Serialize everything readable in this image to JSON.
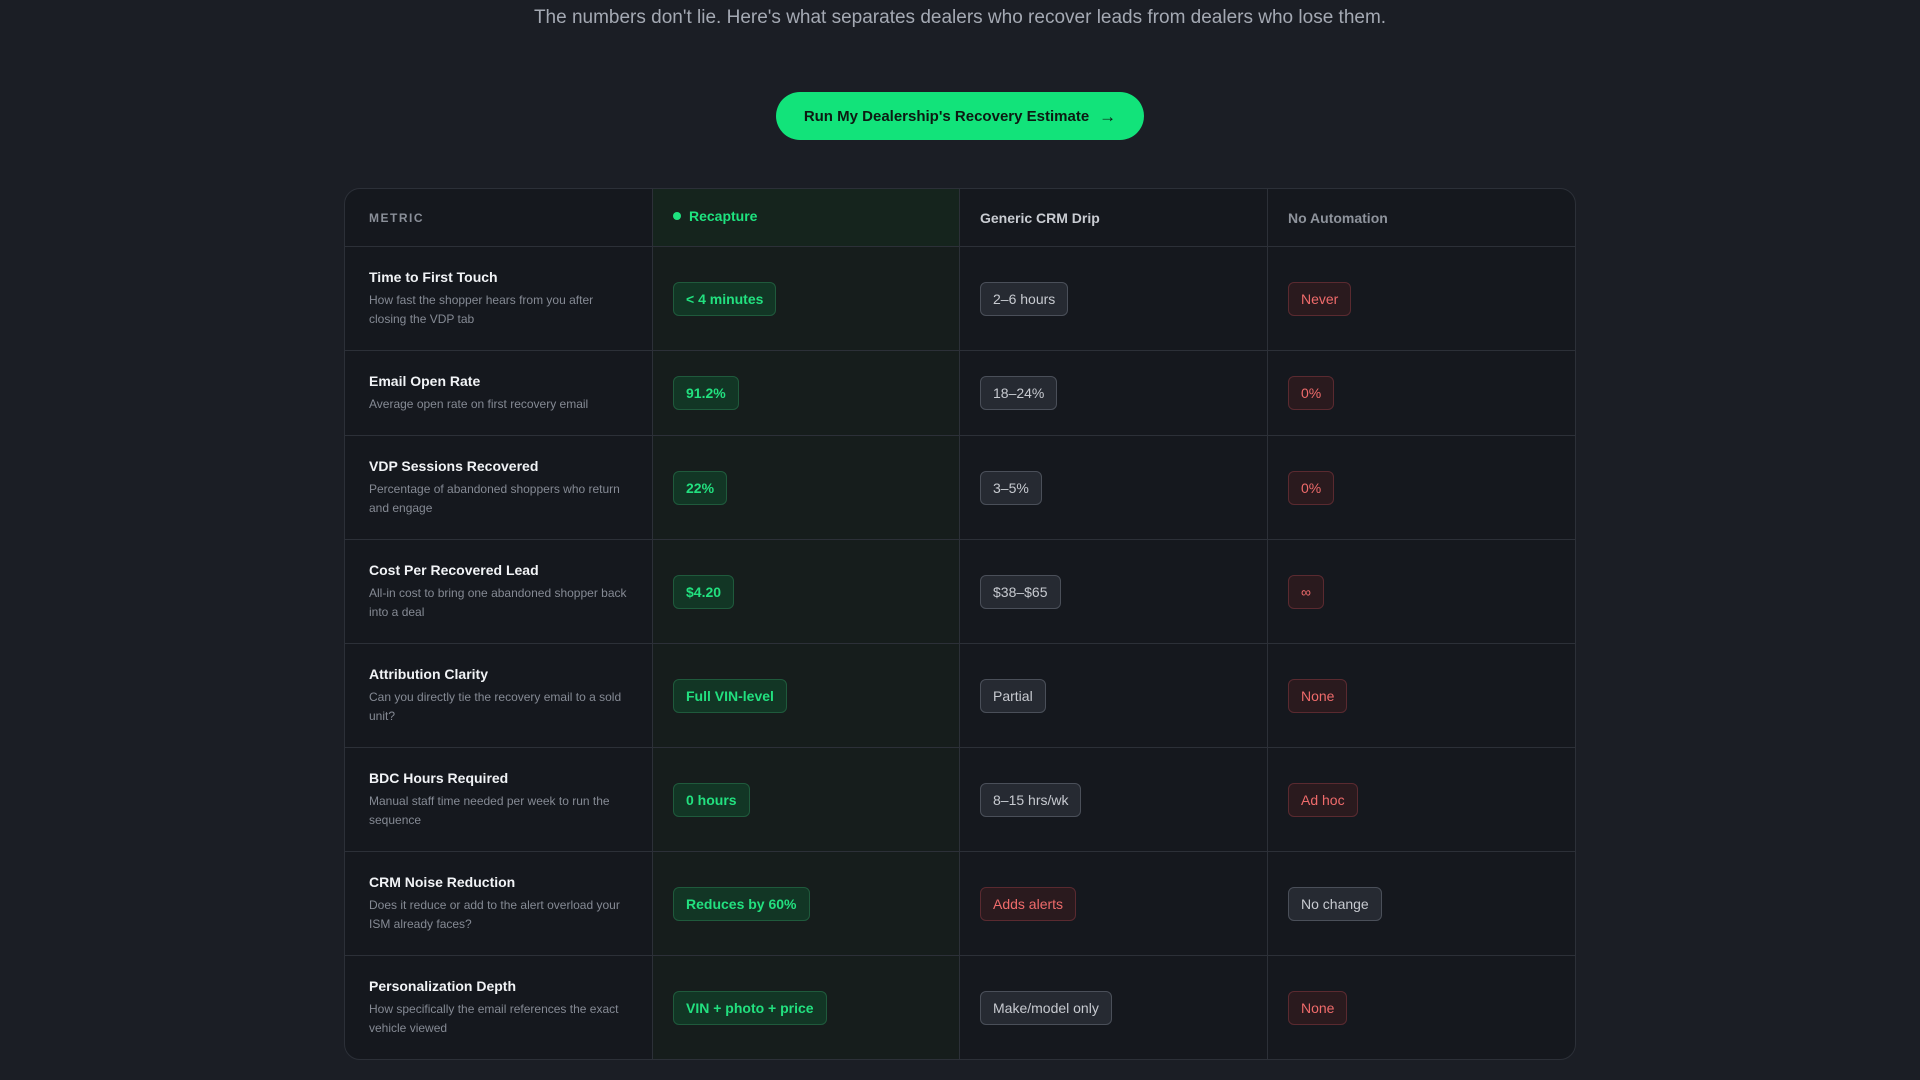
{
  "subtitle": "The numbers don't lie. Here's what separates dealers who recover leads from dealers who lose them.",
  "cta": {
    "label": "Run My Dealership's Recovery Estimate",
    "icon": "arrow-right-icon"
  },
  "table": {
    "headers": {
      "metric": "METRIC",
      "recapture": "Recapture",
      "generic": "Generic CRM Drip",
      "none": "No Automation"
    },
    "rows": [
      {
        "title": "Time to First Touch",
        "desc": "How fast the shopper hears from you after closing the VDP tab",
        "recapture": "< 4 minutes",
        "generic": "2–6 hours",
        "none": "Never"
      },
      {
        "title": "Email Open Rate",
        "desc": "Average open rate on first recovery email",
        "recapture": "91.2%",
        "generic": "18–24%",
        "none": "0%"
      },
      {
        "title": "VDP Sessions Recovered",
        "desc": "Percentage of abandoned shoppers who return and engage",
        "recapture": "22%",
        "generic": "3–5%",
        "none": "0%"
      },
      {
        "title": "Cost Per Recovered Lead",
        "desc": "All-in cost to bring one abandoned shopper back into a deal",
        "recapture": "$4.20",
        "generic": "$38–$65",
        "none": "∞"
      },
      {
        "title": "Attribution Clarity",
        "desc": "Can you directly tie the recovery email to a sold unit?",
        "recapture": "Full VIN-level",
        "generic": "Partial",
        "none": "None"
      },
      {
        "title": "BDC Hours Required",
        "desc": "Manual staff time needed per week to run the sequence",
        "recapture": "0 hours",
        "generic": "8–15 hrs/wk",
        "none": "Ad hoc"
      },
      {
        "title": "CRM Noise Reduction",
        "desc": "Does it reduce or add to the alert overload your ISM already faces?",
        "recapture": "Reduces by 60%",
        "generic": "Adds alerts",
        "none": "No change"
      },
      {
        "title": "Personalization Depth",
        "desc": "How specifically the email references the exact vehicle viewed",
        "recapture": "VIN + photo + price",
        "generic": "Make/model only",
        "none": "None"
      }
    ]
  }
}
